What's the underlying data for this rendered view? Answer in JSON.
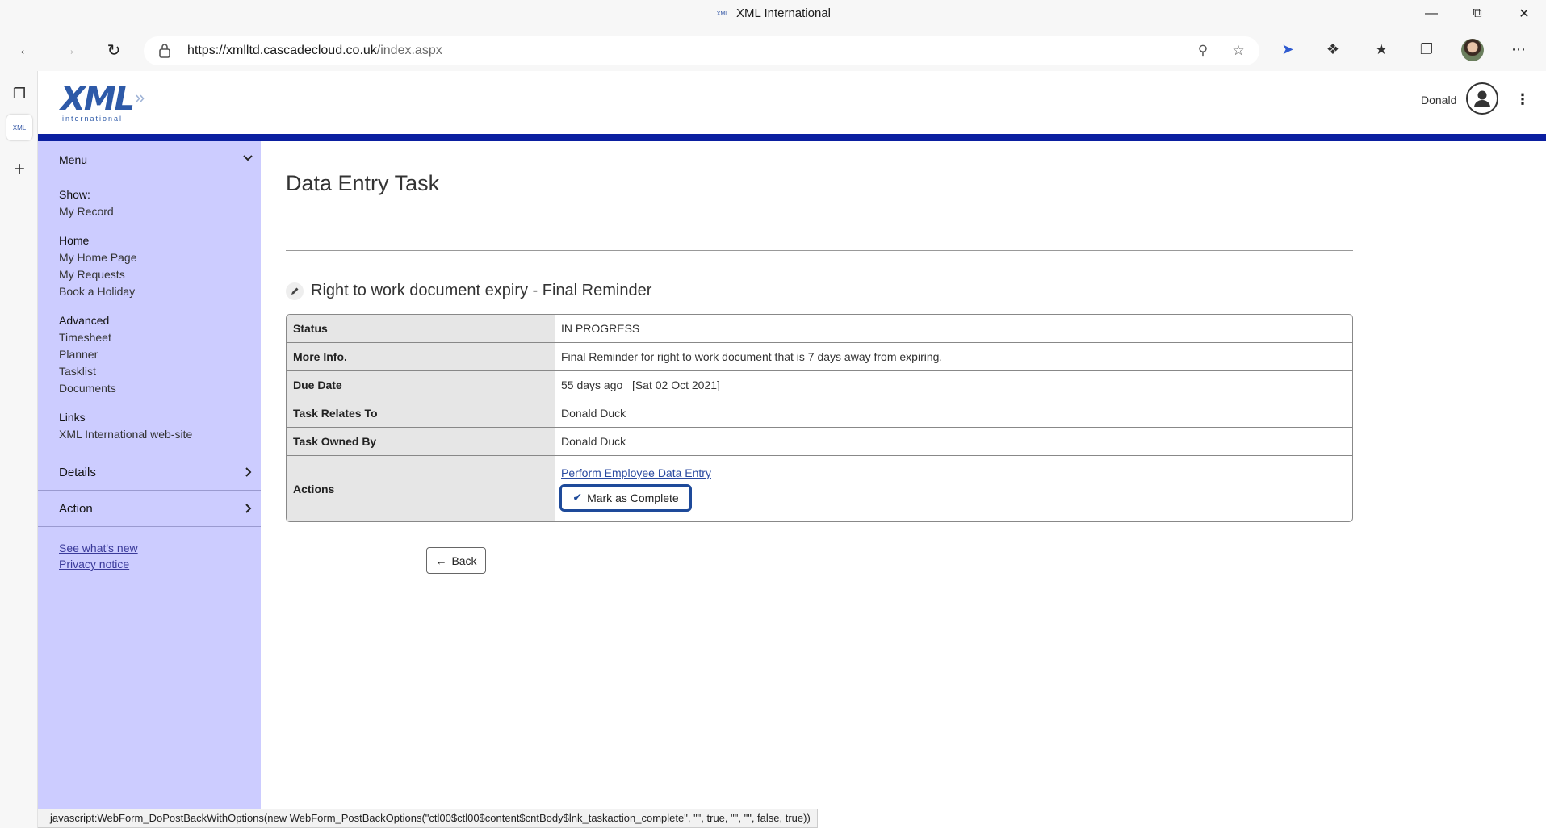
{
  "browser": {
    "window_title": "XML International",
    "favicon_text": "XML",
    "url_host": "https://xmlltd.cascadecloud.co.uk",
    "url_path": "/index.aspx",
    "status_url": "javascript:WebForm_DoPostBackWithOptions(new WebForm_PostBackOptions(\"ctl00$ctl00$content$cntBody$lnk_taskaction_complete\", \"\", true, \"\", \"\", false, true))"
  },
  "header": {
    "logo_text": "XML",
    "logo_sub": "international",
    "user_name": "Donald"
  },
  "sidebar": {
    "menu_label": "Menu",
    "groups": [
      {
        "title": "Show:",
        "items": [
          "My Record"
        ]
      },
      {
        "title": "Home",
        "items": [
          "My Home Page",
          "My Requests",
          "Book a Holiday"
        ]
      },
      {
        "title": "Advanced",
        "items": [
          "Timesheet",
          "Planner",
          "Tasklist",
          "Documents"
        ]
      },
      {
        "title": "Links",
        "items": [
          "XML International web-site"
        ]
      }
    ],
    "sections": [
      "Details",
      "Action"
    ],
    "footer_links": [
      "See what's new",
      "Privacy notice"
    ]
  },
  "main": {
    "title": "Data Entry Task",
    "section_title": "Right to work document expiry - Final Reminder",
    "rows": [
      {
        "label": "Status",
        "value": "IN PROGRESS"
      },
      {
        "label": "More Info.",
        "value": "Final Reminder for right to work document that is 7 days away from expiring."
      },
      {
        "label": "Due Date",
        "value": "55 days ago   [Sat 02 Oct 2021]"
      },
      {
        "label": "Task Relates To",
        "value": "Donald Duck"
      },
      {
        "label": "Task Owned By",
        "value": "Donald Duck"
      }
    ],
    "actions_label": "Actions",
    "action_link": "Perform Employee Data Entry",
    "complete_button": "Mark as Complete",
    "back_button": "Back"
  }
}
